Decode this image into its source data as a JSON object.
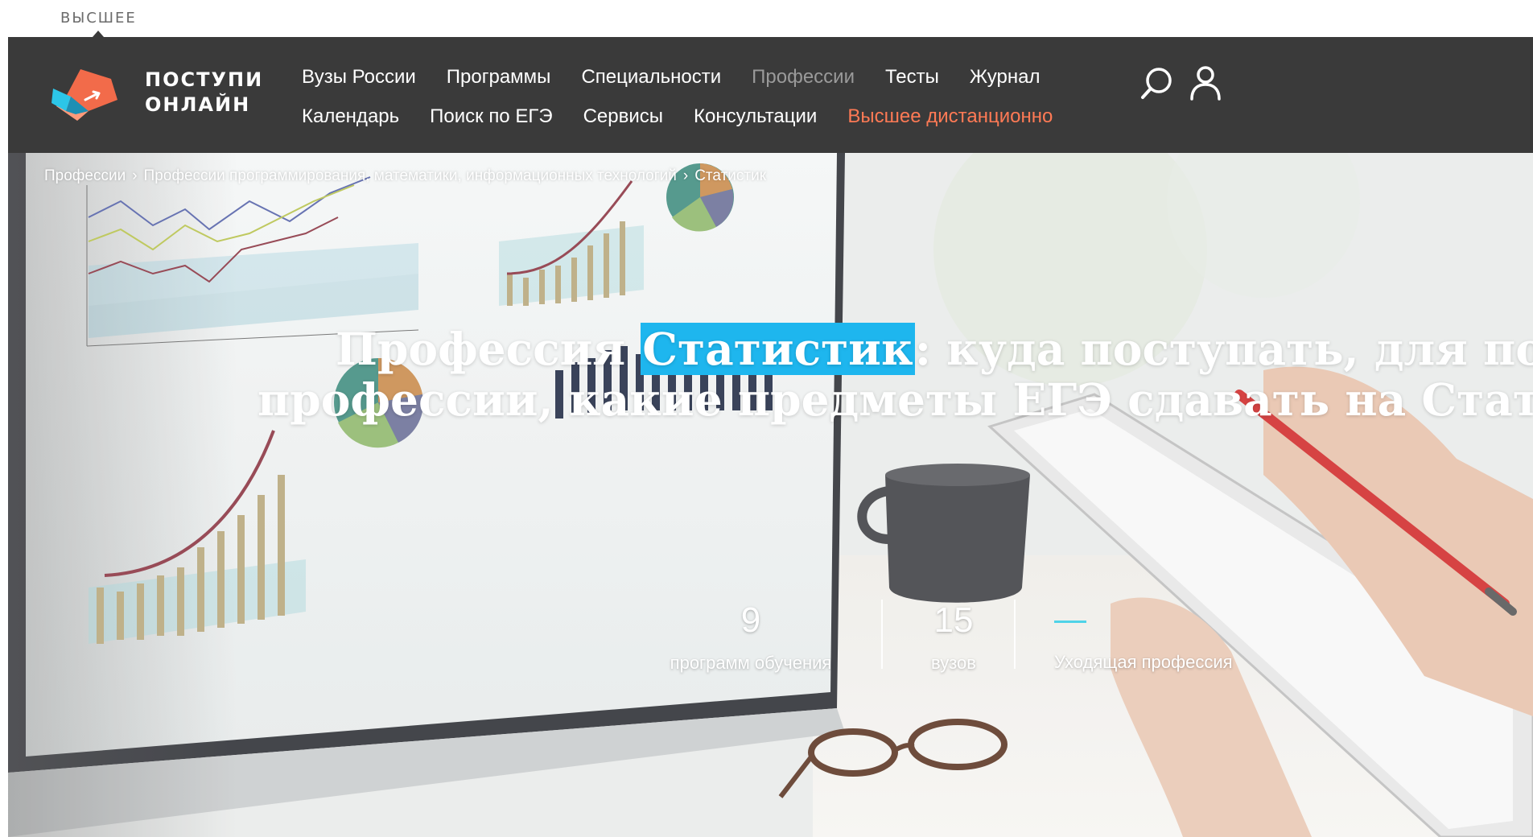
{
  "top_tab": {
    "label": "ВЫСШЕЕ"
  },
  "header": {
    "logo_line1": "ПОСТУПИ",
    "logo_line2": "ОНЛАЙН",
    "nav_row1": [
      {
        "label": "Вузы России",
        "state": "normal"
      },
      {
        "label": "Программы",
        "state": "normal"
      },
      {
        "label": "Специальности",
        "state": "normal"
      },
      {
        "label": "Профессии",
        "state": "active"
      },
      {
        "label": "Тесты",
        "state": "normal"
      },
      {
        "label": "Журнал",
        "state": "normal"
      }
    ],
    "nav_row2": [
      {
        "label": "Календарь",
        "state": "normal"
      },
      {
        "label": "Поиск по ЕГЭ",
        "state": "normal"
      },
      {
        "label": "Сервисы",
        "state": "normal"
      },
      {
        "label": "Консультации",
        "state": "normal"
      },
      {
        "label": "Высшее дистанционно",
        "state": "accent"
      }
    ],
    "icons": [
      "search-icon",
      "user-icon"
    ]
  },
  "breadcrumb": [
    "Профессии",
    "Профессии программирования, математики, информационных технологий",
    "Статистик"
  ],
  "hero": {
    "title_before": "Профессия ",
    "title_highlight": "Статистик",
    "title_after_line1": ": куда поступать, для получения",
    "title_line2": "профессии, какие предметы ЕГЭ сдавать на Статистик"
  },
  "stats": [
    {
      "value": "9",
      "label": "программ обучения"
    },
    {
      "value": "15",
      "label": "вузов"
    },
    {
      "value": "",
      "label": "Уходящая профессия"
    }
  ],
  "colors": {
    "header_bg": "#3a3a3a",
    "accent": "#ff7a55",
    "highlight": "#1eb6ee",
    "stat_dash": "#4fd3e8"
  }
}
